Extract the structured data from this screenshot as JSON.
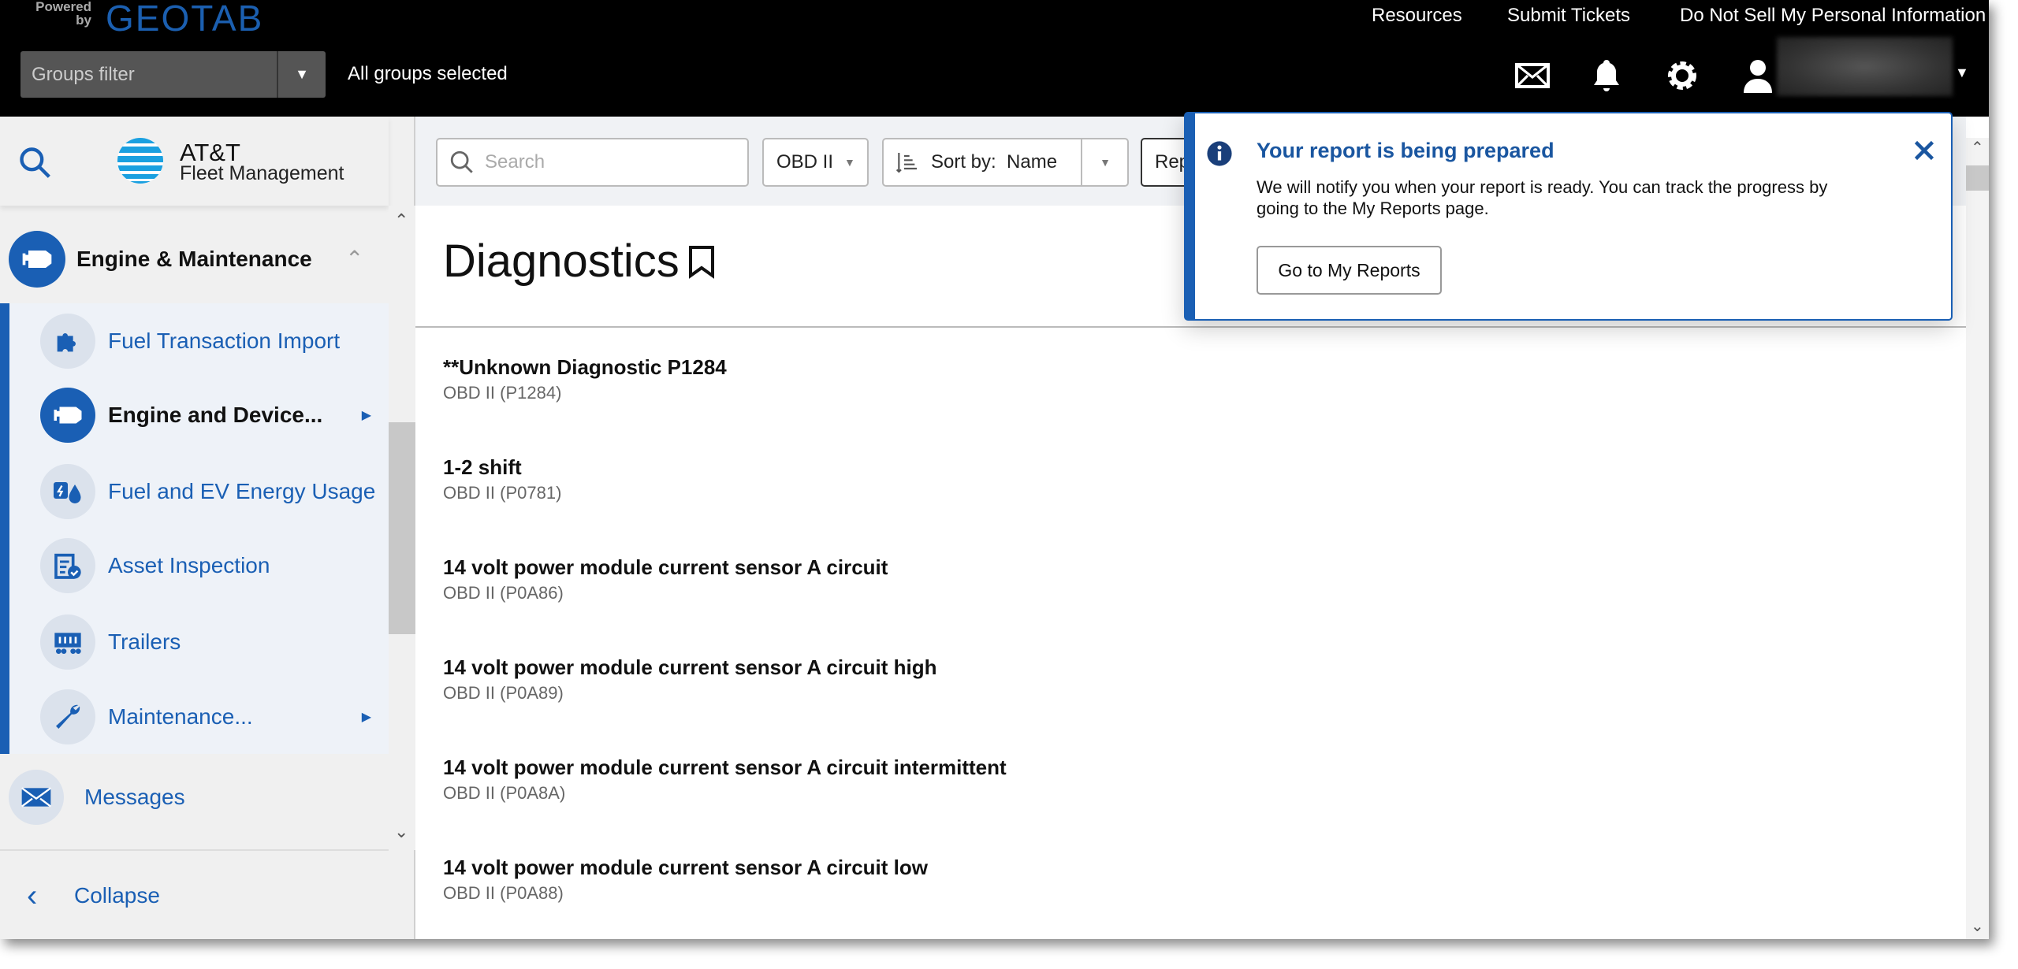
{
  "topbar": {
    "powered_by": "Powered by",
    "brand": "GEOTAB",
    "groups_filter_placeholder": "Groups filter",
    "groups_status": "All groups selected",
    "links": [
      "Resources",
      "Submit Tickets",
      "Do Not Sell My Personal Information"
    ],
    "icons": [
      "mail-icon",
      "bell-icon",
      "gear-icon",
      "user-icon"
    ]
  },
  "sidebar": {
    "logo_line1": "AT&T",
    "logo_line2": "Fleet Management",
    "section": {
      "label": "Engine & Maintenance",
      "icon": "engine-icon"
    },
    "items": [
      {
        "label": "Fuel Transaction Import",
        "icon": "puzzle-icon"
      },
      {
        "label": "Engine and Device...",
        "icon": "engine-icon",
        "active": true,
        "submenu": true
      },
      {
        "label": "Fuel and EV Energy Usage",
        "icon": "fuel-ev-icon"
      },
      {
        "label": "Asset Inspection",
        "icon": "clipboard-check-icon"
      },
      {
        "label": "Trailers",
        "icon": "trailer-icon"
      },
      {
        "label": "Maintenance...",
        "icon": "wrench-icon",
        "submenu": true
      }
    ],
    "messages": "Messages",
    "collapse": "Collapse"
  },
  "toolbar": {
    "search_placeholder": "Search",
    "filter": "OBD II",
    "sort_label": "Sort by:",
    "sort_value": "Name",
    "report_button": "Rep"
  },
  "page": {
    "title": "Diagnostics"
  },
  "diagnostics": [
    {
      "name": "**Unknown Diagnostic P1284",
      "code": "OBD II (P1284)"
    },
    {
      "name": "1-2 shift",
      "code": "OBD II (P0781)"
    },
    {
      "name": "14 volt power module current sensor A circuit",
      "code": "OBD II (P0A86)"
    },
    {
      "name": "14 volt power module current sensor A circuit high",
      "code": "OBD II (P0A89)"
    },
    {
      "name": "14 volt power module current sensor A circuit intermittent",
      "code": "OBD II (P0A8A)"
    },
    {
      "name": "14 volt power module current sensor A circuit low",
      "code": "OBD II (P0A88)"
    }
  ],
  "notification": {
    "title": "Your report is being prepared",
    "body": "We will notify you when your report is ready. You can track the progress by going to the My Reports page.",
    "button": "Go to My Reports"
  },
  "colors": {
    "accent": "#1a5fb4",
    "topbar": "#000000",
    "sidebar": "#f0f0f0"
  }
}
